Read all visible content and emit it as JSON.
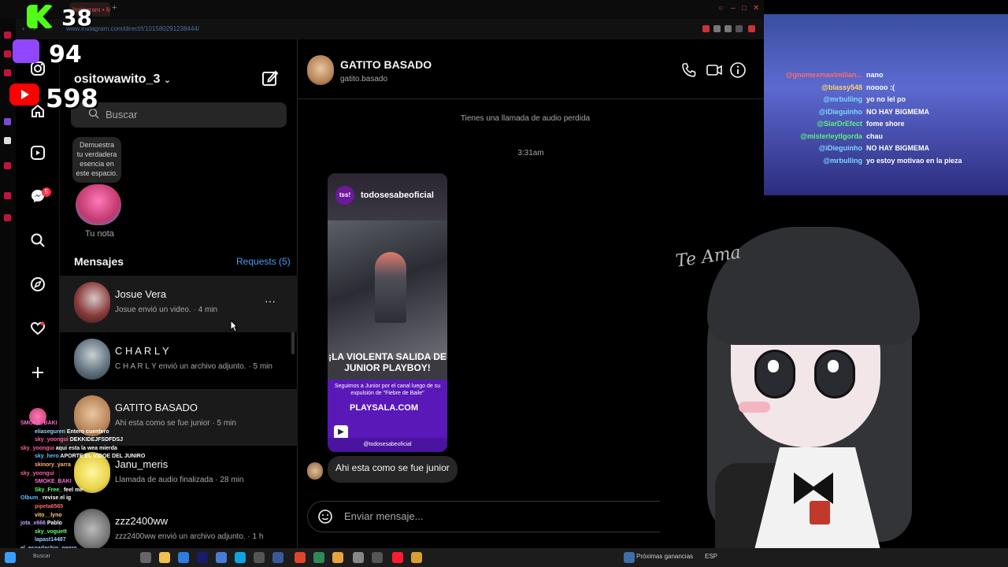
{
  "browser": {
    "tab_title": "Instagram • Mensajes",
    "url": "www.instagram.com/direct/t/101580291238444/"
  },
  "stream": {
    "kick_count": "38",
    "twitch_count": "94",
    "youtube_count": "598",
    "chat": [
      {
        "user": "@gnomexmaxlmilian...",
        "text": "nano",
        "color": "#ff6b6b"
      },
      {
        "user": "@blassy548",
        "text": "noooo :(",
        "color": "#ffd36b"
      },
      {
        "user": "@mrbulling",
        "text": "yo no lel po",
        "color": "#7bd7ff"
      },
      {
        "user": "@iDieguinho",
        "text": "NO HAY BIGMEMA",
        "color": "#7bd7ff"
      },
      {
        "user": "@SlarDrEfect",
        "text": "fome shore",
        "color": "#5af27a"
      },
      {
        "user": "@misterleytlgorda",
        "text": "chau",
        "color": "#5af27a"
      },
      {
        "user": "@iDieguinho",
        "text": "NO HAY BIGMEMA",
        "color": "#7bd7ff"
      },
      {
        "user": "@mrbulling",
        "text": "yo estoy motivao en la pieza",
        "color": "#7bd7ff"
      }
    ],
    "left_feed": [
      {
        "user": "SMOKE_BAKI",
        "text": "",
        "color": "#ff6bd0"
      },
      {
        "user": "eliaseguren",
        "text": "Entero cuentero",
        "color": "#9cf"
      },
      {
        "user": "sky_yoongui",
        "text": "DEKKIDEJFSDFDSJ",
        "color": "#ff5fa2"
      },
      {
        "user": "sky_yoongui",
        "text": "aqui esta la wea mierda",
        "color": "#ff5fa2"
      },
      {
        "user": "sky_hero",
        "text": "APORTE EL VIDOE DEL JUNIRO",
        "color": "#6bf"
      },
      {
        "user": "skinory_yarra",
        "text": "",
        "color": "#ffb36b"
      },
      {
        "user": "sky_yoongui",
        "text": "",
        "color": "#ff5fa2"
      },
      {
        "user": "SMOKE_BAKI",
        "text": "",
        "color": "#ff6bd0"
      },
      {
        "user": "Sky_Free_",
        "text": "feel me",
        "color": "#6f6"
      },
      {
        "user": "Olbum_",
        "text": "revise el ig",
        "color": "#6bf"
      },
      {
        "user": "pipeta6565",
        "text": "",
        "color": "#f66"
      },
      {
        "user": "vito__lyno",
        "text": "",
        "color": "#ffd36b"
      },
      {
        "user": "jota_x666",
        "text": "Pablo",
        "color": "#c9f"
      },
      {
        "user": "sky_voguett",
        "text": "",
        "color": "#6f6"
      },
      {
        "user": "lapast14487",
        "text": "",
        "color": "#9cf"
      },
      {
        "user": "el_espadachin_negro",
        "text": "",
        "color": "#9cf"
      }
    ],
    "signature": "Te Ama"
  },
  "ig": {
    "username": "ositowawito_3",
    "search_placeholder": "Buscar",
    "note_text": "Demuestra tu verdadera esencia en este espacio.",
    "note_label": "Tu nota",
    "messages_header": "Mensajes",
    "requests": "Requests (5)",
    "badge": "5",
    "conversations": [
      {
        "name": "Josue Vera",
        "sub": "Josue envió un video. · 4 min",
        "active": true,
        "color": "#8a3a3a"
      },
      {
        "name": "C H A R L Y",
        "sub": "C H A R L Y envió un archivo adjunto. · 5 min",
        "active": false,
        "color": "#5b6e7a"
      },
      {
        "name": "GATITO BASADO",
        "sub": "Ahi esta como se fue junior · 5 min",
        "active": true,
        "color": "#b9865a"
      },
      {
        "name": "Janu_meris",
        "sub": "Llamada de audio finalizada · 28 min",
        "active": false,
        "color": "#e9d34a"
      },
      {
        "name": "zzz2400ww",
        "sub": "zzz2400ww envió un archivo adjunto. · 1 h",
        "active": false,
        "color": "#777"
      }
    ],
    "chat": {
      "name": "GATITO BASADO",
      "handle": "gatito.basado",
      "missed_call": "Tienes una llamada de audio perdida",
      "time": "3:31am",
      "caption": "Ahi esta como se fue junior",
      "input_placeholder": "Enviar mensaje..."
    },
    "post": {
      "handle": "todosesabeoficial",
      "logo": "tss!",
      "title": "¡LA VIOLENTA SALIDA DE JUNIOR PLAYBOY!",
      "desc": "Seguimos a Junior por el canal luego de su expulsión de \"Fiebre de Baile\"",
      "site": "PLAYSALA.COM",
      "footer": "@todosesabeoficial"
    }
  },
  "taskbar": {
    "search": "Buscar",
    "weather": "Próximas ganancias",
    "lang": "ESP"
  }
}
